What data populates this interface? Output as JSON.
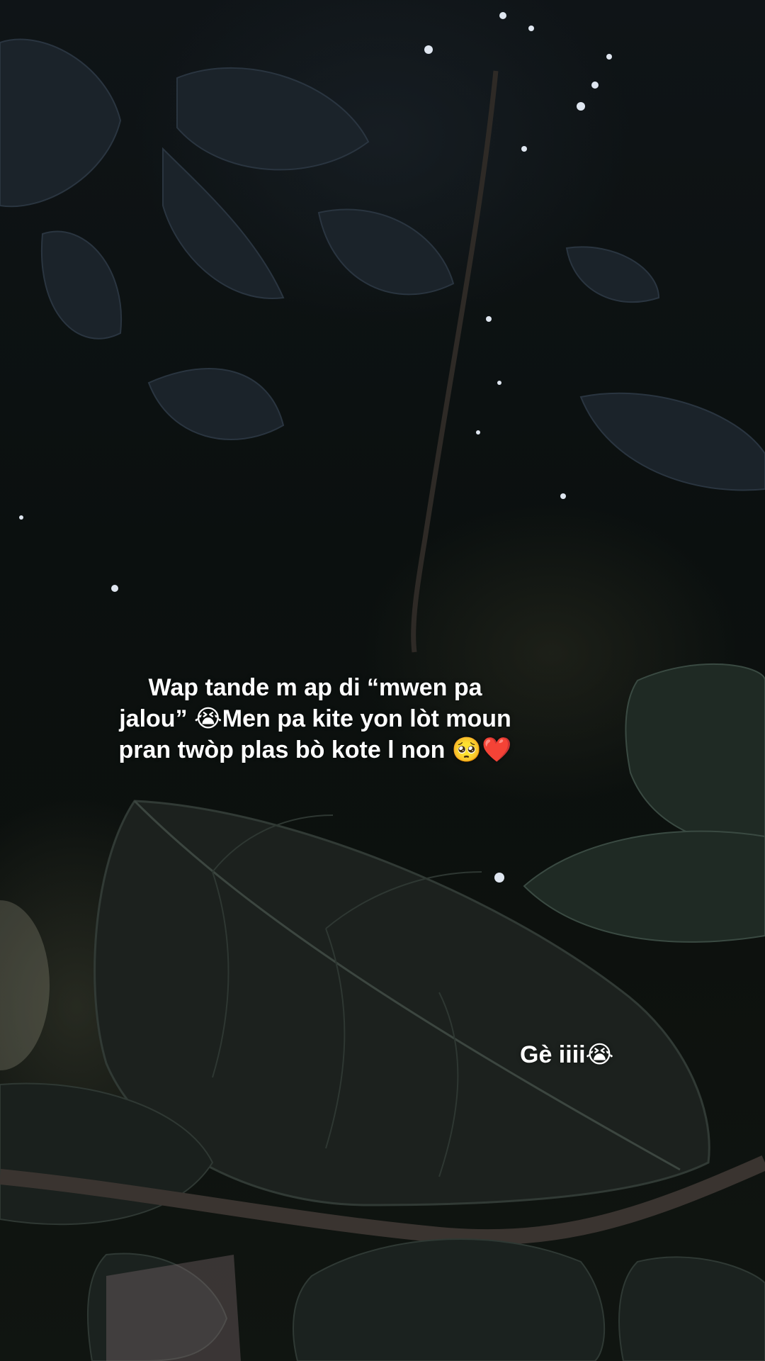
{
  "captions": {
    "main": "Wap tande m ap di “mwen pa\njalou” 😭Men pa kite yon lòt moun\npran twòp plas bò kote l non 🥺❤️",
    "secondary": "Gè iiii😭"
  }
}
